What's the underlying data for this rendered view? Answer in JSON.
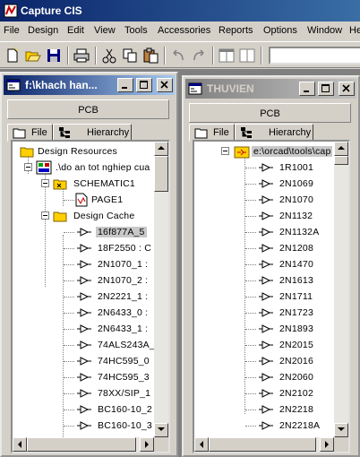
{
  "app": {
    "title": "Capture CIS"
  },
  "menu": [
    "File",
    "Design",
    "Edit",
    "View",
    "Tools",
    "Accessories",
    "Reports",
    "Options",
    "Window",
    "He"
  ],
  "left_window": {
    "title": "f:\\khach han...",
    "pcb_tab": "PCB",
    "tabs": [
      "File",
      "Hierarchy"
    ],
    "tree": [
      {
        "label": "Design Resources",
        "icon": "folder-icon",
        "level": 0
      },
      {
        "label": ".\\do an tot nghiep cua",
        "icon": "design-icon",
        "level": 1,
        "expander": true
      },
      {
        "label": "SCHEMATIC1",
        "icon": "schematic-folder-icon",
        "level": 2,
        "expander": true
      },
      {
        "label": "PAGE1",
        "icon": "page-icon",
        "level": 3
      },
      {
        "label": "Design Cache",
        "icon": "folder-icon",
        "level": 2,
        "expander": true
      },
      {
        "label": "16f877A_5",
        "icon": "part-icon",
        "level": 3,
        "selected": true
      },
      {
        "label": "18F2550 : C",
        "icon": "part-icon",
        "level": 3
      },
      {
        "label": "2N1070_1 :",
        "icon": "part-icon",
        "level": 3
      },
      {
        "label": "2N1070_2 :",
        "icon": "part-icon",
        "level": 3
      },
      {
        "label": "2N2221_1 :",
        "icon": "part-icon",
        "level": 3
      },
      {
        "label": "2N6433_0 :",
        "icon": "part-icon",
        "level": 3
      },
      {
        "label": "2N6433_1 :",
        "icon": "part-icon",
        "level": 3
      },
      {
        "label": "74ALS243A_",
        "icon": "part-icon",
        "level": 3
      },
      {
        "label": "74HC595_0",
        "icon": "part-icon",
        "level": 3
      },
      {
        "label": "74HC595_3",
        "icon": "part-icon",
        "level": 3
      },
      {
        "label": "78XX/SIP_1",
        "icon": "part-icon",
        "level": 3
      },
      {
        "label": "BC160-10_2",
        "icon": "part-icon",
        "level": 3
      },
      {
        "label": "BC160-10_3",
        "icon": "part-icon",
        "level": 3
      }
    ]
  },
  "right_window": {
    "title": "THUVIEN",
    "pcb_tab": "PCB",
    "tabs": [
      "File",
      "Hierarchy"
    ],
    "library_path": "e:\\orcad\\tools\\cap",
    "parts": [
      "1R1001",
      "2N1069",
      "2N1070",
      "2N1132",
      "2N1132A",
      "2N1208",
      "2N1470",
      "2N1613",
      "2N1711",
      "2N1723",
      "2N1893",
      "2N2015",
      "2N2016",
      "2N2060",
      "2N2102",
      "2N2218",
      "2N2218A"
    ]
  },
  "colors": {
    "active_title": "#0a246a",
    "inactive_title": "#808080",
    "face": "#d4d0c8",
    "workspace": "#808080"
  }
}
